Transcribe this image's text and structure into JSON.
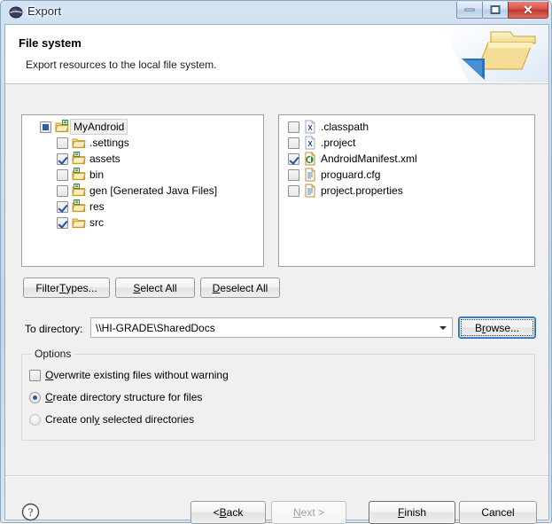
{
  "window": {
    "title": "Export",
    "icon": "eclipse-icon",
    "controls": {
      "minimize": "Minimize",
      "maximize": "Maximize",
      "close": "Close"
    }
  },
  "banner": {
    "title": "File system",
    "subtitle": "Export resources to the local file system.",
    "icon": "folder-export-icon"
  },
  "tree": {
    "items": [
      {
        "label": "MyAndroid",
        "check": "grayed",
        "icon": "project-folder-icon",
        "indent": 0,
        "selected": true
      },
      {
        "label": ".settings",
        "check": "unchecked",
        "icon": "folder-icon",
        "indent": 1,
        "selected": false
      },
      {
        "label": "assets",
        "check": "checked",
        "icon": "source-folder-icon",
        "indent": 1,
        "selected": false
      },
      {
        "label": "bin",
        "check": "unchecked",
        "icon": "source-folder-icon",
        "indent": 1,
        "selected": false
      },
      {
        "label": "gen [Generated Java Files]",
        "check": "unchecked",
        "icon": "source-folder-icon",
        "indent": 1,
        "selected": false
      },
      {
        "label": "res",
        "check": "checked",
        "icon": "source-folder-icon",
        "indent": 1,
        "selected": false
      },
      {
        "label": "src",
        "check": "checked",
        "icon": "folder-icon",
        "indent": 1,
        "selected": false
      }
    ]
  },
  "files": {
    "items": [
      {
        "label": ".classpath",
        "check": "unchecked",
        "icon": "xml-file-icon"
      },
      {
        "label": ".project",
        "check": "unchecked",
        "icon": "xml-file-icon"
      },
      {
        "label": "AndroidManifest.xml",
        "check": "checked",
        "icon": "android-manifest-icon"
      },
      {
        "label": "proguard.cfg",
        "check": "unchecked",
        "icon": "text-file-icon"
      },
      {
        "label": "project.properties",
        "check": "unchecked",
        "icon": "text-file-icon"
      }
    ]
  },
  "toolbar": {
    "filter_types": "Filter Types...",
    "filter_types_pre": "Filter ",
    "filter_types_accel": "T",
    "filter_types_post": "ypes...",
    "select_all_pre": "",
    "select_all_accel": "S",
    "select_all_post": "elect All",
    "deselect_all_pre": "",
    "deselect_all_accel": "D",
    "deselect_all_post": "eselect All"
  },
  "directory": {
    "label": "To directory:",
    "value": "\\\\HI-GRADE\\SharedDocs",
    "placeholder": "",
    "browse_pre": "B",
    "browse_accel": "r",
    "browse_post": "owse..."
  },
  "options": {
    "title": "Options",
    "items": [
      {
        "type": "checkbox",
        "state": "unchecked",
        "pre": "",
        "accel": "O",
        "post": "verwrite existing files without warning"
      },
      {
        "type": "radio",
        "state": "selected",
        "pre": "",
        "accel": "C",
        "post": "reate directory structure for files"
      },
      {
        "type": "radio",
        "state": "unselected",
        "pre": "Create onl",
        "accel": "y",
        "post": " selected directories"
      }
    ]
  },
  "footer": {
    "help": "?",
    "back_pre": "< ",
    "back_accel": "B",
    "back_post": "ack",
    "next_pre": "",
    "next_accel": "N",
    "next_post": "ext >",
    "finish_pre": "",
    "finish_accel": "F",
    "finish_post": "inish",
    "cancel_pre": "Cancel",
    "cancel_accel": "",
    "cancel_post": ""
  },
  "colors": {
    "accent": "#2a6099",
    "close_button": "#c0392b",
    "titlebar": "#c9ddf0",
    "panel_bg": "#ffffff",
    "dialog_bg": "#f0f0f0"
  }
}
